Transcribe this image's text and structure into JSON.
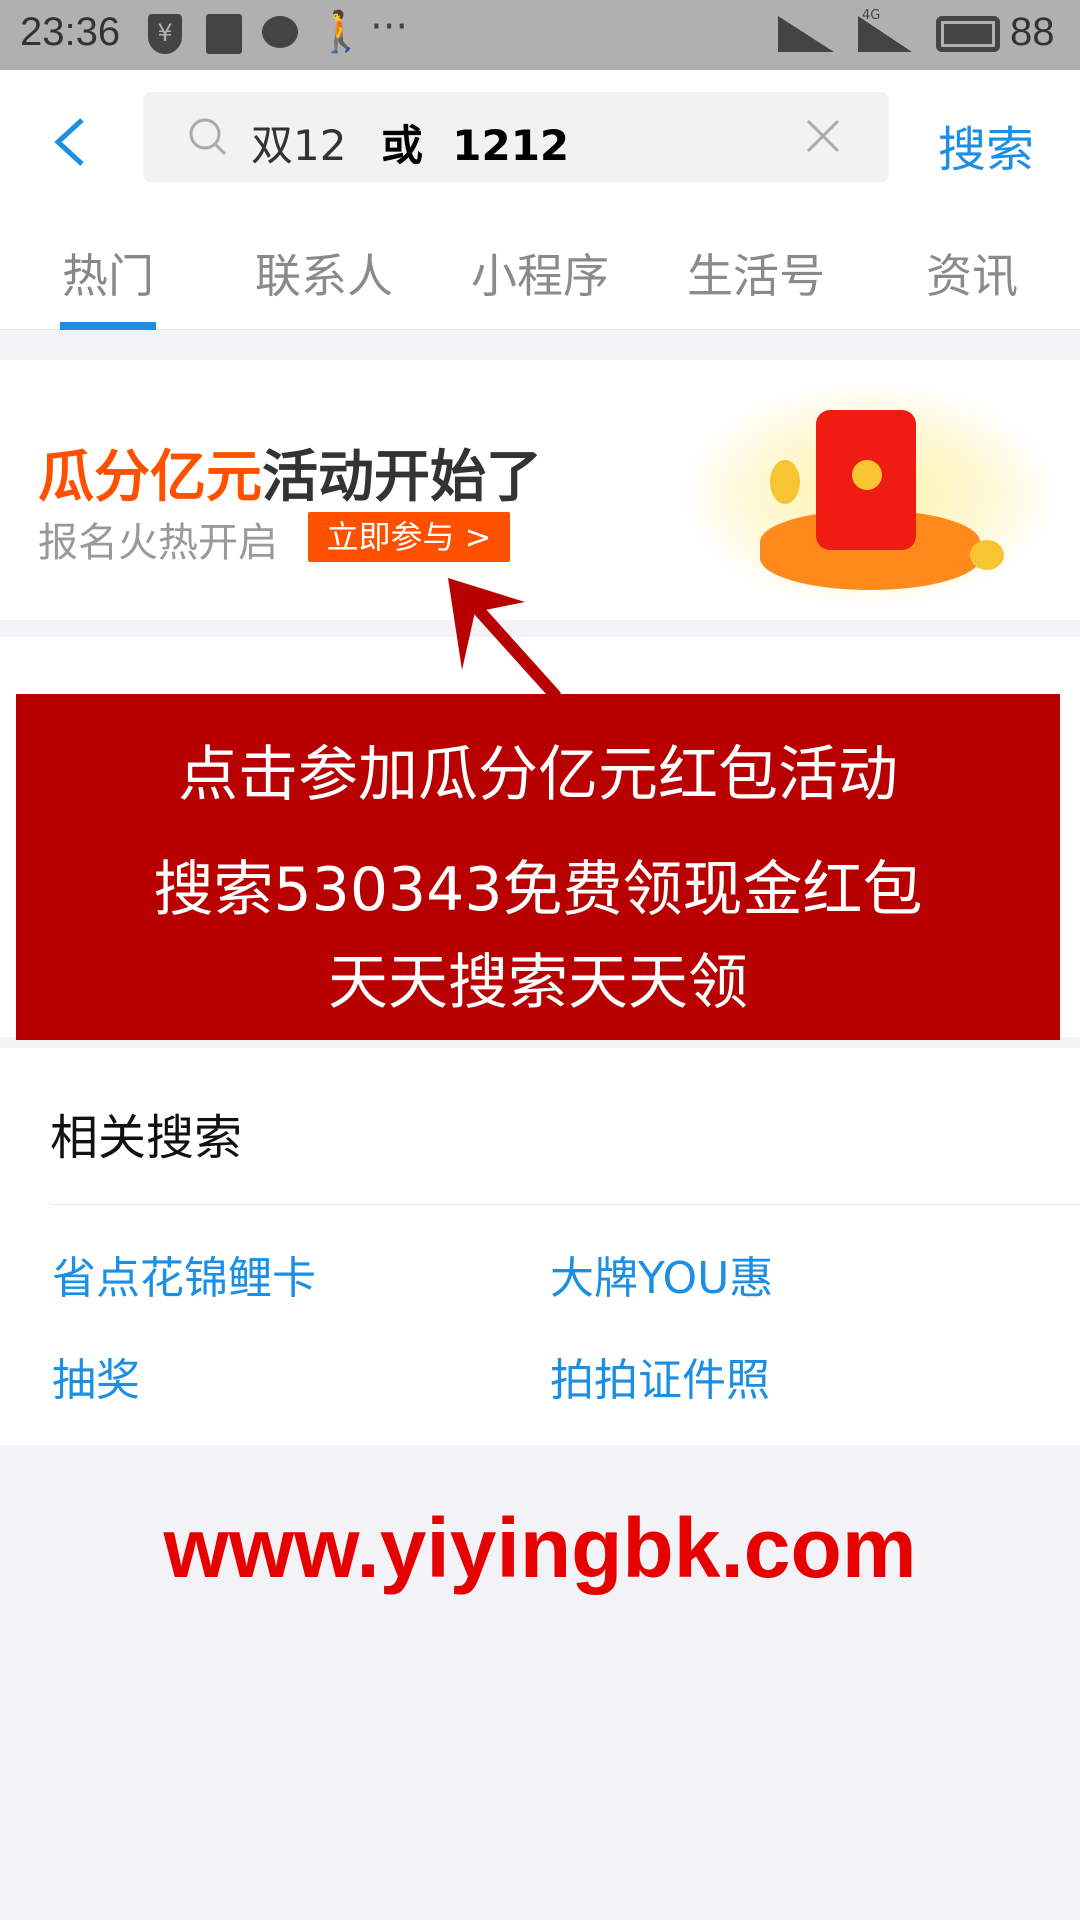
{
  "status_bar": {
    "time": "23:36",
    "battery": "88",
    "network": "4G"
  },
  "header": {
    "search_query_main": "双12",
    "search_query_extra": "或  1212",
    "search_button": "搜索"
  },
  "tabs": [
    {
      "label": "热门",
      "active": true
    },
    {
      "label": "联系人"
    },
    {
      "label": "小程序"
    },
    {
      "label": "生活号"
    },
    {
      "label": "资讯"
    }
  ],
  "banner": {
    "title_highlight": "瓜分亿元",
    "title_rest": "活动开始了",
    "subtitle": "报名火热开启",
    "cta": "立即参与 >"
  },
  "overlay": {
    "line1": "点击参加瓜分亿元红包活动",
    "line2": "搜索530343免费领现金红包",
    "line3": "天天搜索天天领"
  },
  "related": {
    "title": "相关搜索",
    "items": [
      "省点花锦鲤卡",
      "大牌YOU惠",
      "抽奖",
      "拍拍证件照"
    ]
  },
  "watermark": "www.yiyingbk.com",
  "colors": {
    "accent": "#1a8fe3",
    "orange": "#ff5000",
    "overlay_red": "#b80000",
    "watermark": "#e60000"
  }
}
